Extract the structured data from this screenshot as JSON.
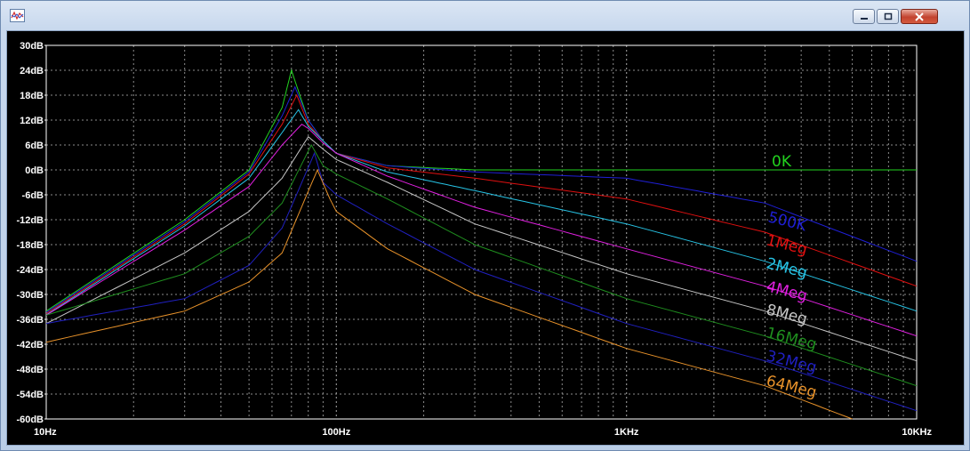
{
  "window": {
    "title": ""
  },
  "chart_data": {
    "type": "line",
    "xscale": "log",
    "xlim": [
      10,
      10000
    ],
    "ylim": [
      -60,
      30
    ],
    "y_tick_labels": [
      "30dB",
      "24dB",
      "18dB",
      "12dB",
      "6dB",
      "0dB",
      "-6dB",
      "-12dB",
      "-18dB",
      "-24dB",
      "-30dB",
      "-36dB",
      "-42dB",
      "-48dB",
      "-54dB",
      "-60dB"
    ],
    "y_ticks": [
      30,
      24,
      18,
      12,
      6,
      0,
      -6,
      -12,
      -18,
      -24,
      -30,
      -36,
      -42,
      -48,
      -54,
      -60
    ],
    "x_tick_labels": [
      "10Hz",
      "100Hz",
      "1KHz",
      "10KHz"
    ],
    "x_ticks": [
      10,
      100,
      1000,
      10000
    ],
    "grid": true,
    "background": "#000000",
    "series": [
      {
        "name": "0K",
        "color": "#22d21f",
        "x": [
          10,
          30,
          50,
          65,
          70,
          80,
          90,
          100,
          150,
          300,
          1000,
          3000,
          10000
        ],
        "y": [
          -34,
          -12,
          0,
          15,
          24,
          12,
          7,
          4,
          1,
          0,
          0,
          0,
          0
        ]
      },
      {
        "name": "500K",
        "color": "#1f1fd6",
        "x": [
          10,
          30,
          50,
          65,
          72,
          80,
          90,
          100,
          150,
          300,
          1000,
          3000,
          10000
        ],
        "y": [
          -34.3,
          -12.5,
          -0.5,
          13,
          20,
          12,
          7,
          4,
          1,
          -0.5,
          -2,
          -8,
          -22
        ]
      },
      {
        "name": "1Meg",
        "color": "#e01010",
        "x": [
          10,
          30,
          50,
          65,
          73,
          80,
          90,
          100,
          150,
          300,
          1000,
          3000,
          10000
        ],
        "y": [
          -34.6,
          -13,
          -1,
          11,
          18,
          11,
          7,
          4,
          0.5,
          -2,
          -7,
          -15,
          -28
        ]
      },
      {
        "name": "2Meg",
        "color": "#27c4e6",
        "x": [
          10,
          30,
          50,
          65,
          74,
          80,
          90,
          100,
          150,
          300,
          1000,
          3000,
          10000
        ],
        "y": [
          -34.9,
          -13.5,
          -2,
          9,
          14.5,
          10.5,
          7,
          4,
          -0.5,
          -5,
          -13,
          -22,
          -34
        ]
      },
      {
        "name": "4Meg",
        "color": "#e020e0",
        "x": [
          10,
          30,
          50,
          65,
          76,
          80,
          90,
          100,
          150,
          300,
          1000,
          3000,
          10000
        ],
        "y": [
          -35,
          -14.5,
          -4,
          6,
          11,
          10,
          6.5,
          4,
          -1.5,
          -9,
          -19,
          -28,
          -40
        ]
      },
      {
        "name": "8Meg",
        "color": "#c8c8c8",
        "x": [
          10,
          30,
          50,
          65,
          80,
          90,
          100,
          150,
          300,
          1000,
          3000,
          10000
        ],
        "y": [
          -37,
          -20,
          -10,
          -2,
          8,
          5,
          2.5,
          -3,
          -13,
          -25,
          -34,
          -46
        ]
      },
      {
        "name": "16Meg",
        "color": "#1f8f1f",
        "x": [
          10,
          30,
          50,
          65,
          82,
          90,
          100,
          150,
          300,
          1000,
          3000,
          10000
        ],
        "y": [
          -35,
          -25,
          -16,
          -8,
          6,
          1,
          -1,
          -7,
          -18,
          -31,
          -40,
          -52
        ]
      },
      {
        "name": "32Meg",
        "color": "#2020c0",
        "x": [
          10,
          30,
          50,
          65,
          84,
          90,
          100,
          150,
          300,
          1000,
          3000,
          10000
        ],
        "y": [
          -37,
          -31,
          -23,
          -14,
          4,
          -3,
          -6,
          -13,
          -24,
          -37,
          -46,
          -58
        ]
      },
      {
        "name": "64Meg",
        "color": "#e8922a",
        "x": [
          10,
          30,
          50,
          65,
          86,
          95,
          100,
          150,
          300,
          1000,
          3000,
          6000
        ],
        "y": [
          -41.5,
          -34,
          -27,
          -20,
          0,
          -7,
          -10,
          -19,
          -30,
          -43,
          -52,
          -60
        ]
      }
    ],
    "label_colors": [
      "#22d21f",
      "#1f1fd6",
      "#e01010",
      "#27c4e6",
      "#e020e0",
      "#c8c8c8",
      "#1f8f1f",
      "#2020c0",
      "#e8922a"
    ]
  }
}
